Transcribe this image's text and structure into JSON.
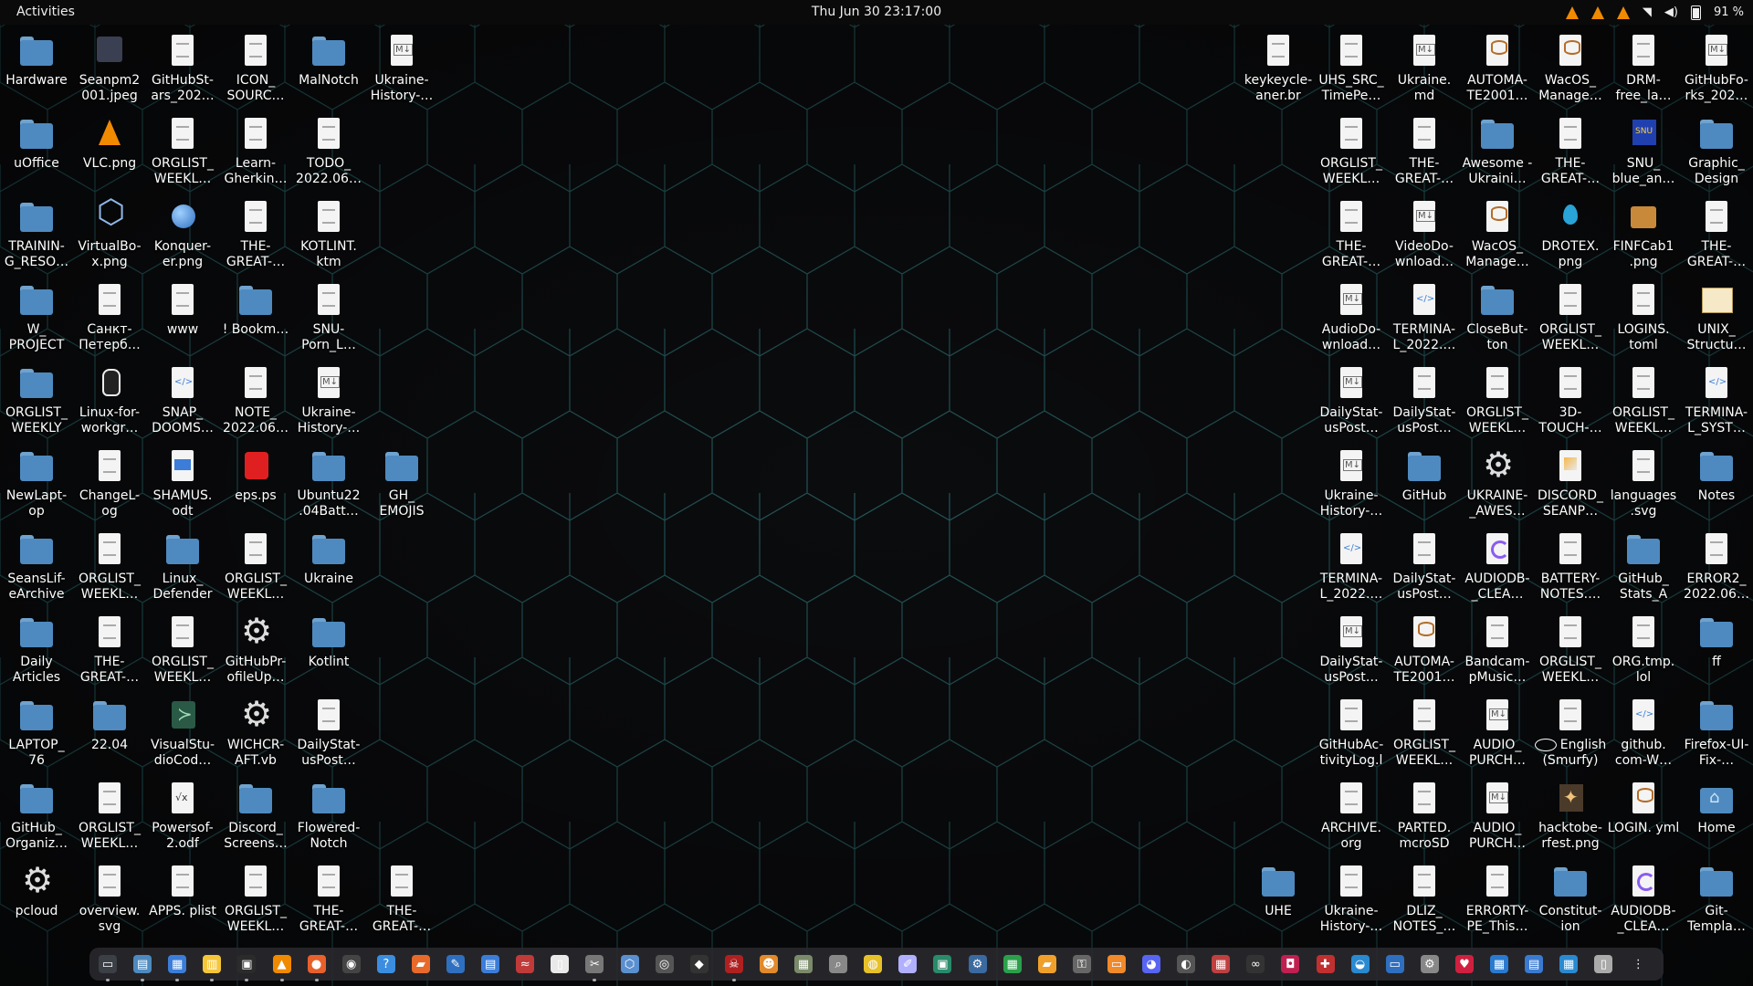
{
  "topbar": {
    "activities": "Activities",
    "clock": "Thu Jun 30  23:17:00",
    "battery": "91 %"
  },
  "desktop": {
    "left_icons": [
      {
        "label": "Hardware",
        "icon": "folder"
      },
      {
        "label": "Seanpm2 001.jpeg",
        "icon": "image"
      },
      {
        "label": "GitHubSt-ars_202…",
        "icon": "document"
      },
      {
        "label": "ICON_ SOURC…",
        "icon": "document"
      },
      {
        "label": "MalNotch",
        "icon": "folder"
      },
      {
        "label": "Ukraine-History-…",
        "icon": "markdown"
      },
      {
        "label": "uOffice",
        "icon": "folder"
      },
      {
        "label": "VLC.png",
        "icon": "vlc"
      },
      {
        "label": "ORGLIST_ WEEKL…",
        "icon": "document"
      },
      {
        "label": "Learn-Gherkin…",
        "icon": "document"
      },
      {
        "label": "TODO_ 2022.06…",
        "icon": "document"
      },
      {
        "label": "TRAININ-G_RESO…",
        "icon": "folder"
      },
      {
        "label": "VirtualBo-x.png",
        "icon": "virtualbox"
      },
      {
        "label": "Konquer-er.png",
        "icon": "globe"
      },
      {
        "label": "THE-GREAT-…",
        "icon": "document"
      },
      {
        "label": "KOTLINT. ktm",
        "icon": "document"
      },
      {
        "label": "W_ PROJECT",
        "icon": "folder"
      },
      {
        "label": "Санкт-Петерб…",
        "icon": "document"
      },
      {
        "label": "www",
        "icon": "document"
      },
      {
        "label": "! Bookm…",
        "icon": "folder"
      },
      {
        "label": "SNU-Porn_L…",
        "icon": "document"
      },
      {
        "label": "ORGLIST_ WEEKLY",
        "icon": "folder"
      },
      {
        "label": "Linux-for-workgr…",
        "icon": "tux"
      },
      {
        "label": "SNAP_ DOOMS…",
        "icon": "code"
      },
      {
        "label": "NOTE_ 2022.06…",
        "icon": "document"
      },
      {
        "label": "Ukraine-History-…",
        "icon": "markdown"
      },
      {
        "label": "NewLapt-op",
        "icon": "folder"
      },
      {
        "label": "ChangeL-og",
        "icon": "document"
      },
      {
        "label": "SHAMUS. odt",
        "icon": "odt"
      },
      {
        "label": "eps.ps",
        "icon": "postscript"
      },
      {
        "label": "Ubuntu22 .04Batt…",
        "icon": "folder"
      },
      {
        "label": "GH_ EMOJIS",
        "icon": "folder"
      },
      {
        "label": "SeansLif-eArchive",
        "icon": "folder"
      },
      {
        "label": "ORGLIST_ WEEKL…",
        "icon": "document"
      },
      {
        "label": "Linux_ Defender",
        "icon": "folder"
      },
      {
        "label": "ORGLIST_ WEEKL…",
        "icon": "document"
      },
      {
        "label": "Ukraine",
        "icon": "folder"
      },
      {
        "label": "Daily Articles",
        "icon": "folder"
      },
      {
        "label": "THE-GREAT-…",
        "icon": "document"
      },
      {
        "label": "ORGLIST_ WEEKL…",
        "icon": "document"
      },
      {
        "label": "GitHubPr-ofileUp…",
        "icon": "gear"
      },
      {
        "label": "Kotlint",
        "icon": "folder"
      },
      {
        "label": "LAPTOP_ 76",
        "icon": "folder"
      },
      {
        "label": "22.04",
        "icon": "folder"
      },
      {
        "label": "VisualStu-dioCod…",
        "icon": "vscode"
      },
      {
        "label": "WICHCR-AFT.vb",
        "icon": "gear"
      },
      {
        "label": "DailyStat-usPost…",
        "icon": "document"
      },
      {
        "label": "GitHub_ Organiz…",
        "icon": "folder"
      },
      {
        "label": "ORGLIST_ WEEKL…",
        "icon": "document"
      },
      {
        "label": "Powersof-2.odf",
        "icon": "formula"
      },
      {
        "label": "Discord_ Screens…",
        "icon": "folder"
      },
      {
        "label": "Flowered-Notch",
        "icon": "folder"
      },
      {
        "label": "pcloud",
        "icon": "gear"
      },
      {
        "label": "overview. svg",
        "icon": "document"
      },
      {
        "label": "APPS. plist",
        "icon": "document"
      },
      {
        "label": "ORGLIST_ WEEKL…",
        "icon": "document"
      },
      {
        "label": "THE-GREAT-…",
        "icon": "document"
      },
      {
        "label": "THE-GREAT-…",
        "icon": "document"
      }
    ],
    "right_icons": [
      {
        "label": "keykeycle-aner.br",
        "icon": "document"
      },
      {
        "label": "UHS_SRC_ TimePe…",
        "icon": "document"
      },
      {
        "label": "Ukraine. md",
        "icon": "markdown"
      },
      {
        "label": "AUTOMA-TE2001…",
        "icon": "database"
      },
      {
        "label": "WacOS_ Manage…",
        "icon": "database"
      },
      {
        "label": "DRM-free_la…",
        "icon": "document"
      },
      {
        "label": "GitHubFo-rks_202…",
        "icon": "markdown"
      },
      {
        "label": "ORGLIST_ WEEKL…",
        "icon": "document"
      },
      {
        "label": "THE-GREAT-…",
        "icon": "document"
      },
      {
        "label": "Awesome -Ukraini…",
        "icon": "folder"
      },
      {
        "label": "THE-GREAT-…",
        "icon": "document"
      },
      {
        "label": "SNU_ blue_an…",
        "icon": "snu"
      },
      {
        "label": "Graphic_ Design",
        "icon": "folder"
      },
      {
        "label": "THE-GREAT-…",
        "icon": "document"
      },
      {
        "label": "VideoDo-wnload…",
        "icon": "markdown"
      },
      {
        "label": "WacOS_ Manage…",
        "icon": "database"
      },
      {
        "label": "DROTEX. png",
        "icon": "drop"
      },
      {
        "label": "FINFCab1 .png",
        "icon": "cabinet"
      },
      {
        "label": "THE-GREAT-…",
        "icon": "document"
      },
      {
        "label": "AudioDo-wnload…",
        "icon": "markdown"
      },
      {
        "label": "TERMINA-L_2022.…",
        "icon": "code"
      },
      {
        "label": "CloseBut-ton",
        "icon": "folder"
      },
      {
        "label": "ORGLIST_ WEEKL…",
        "icon": "document"
      },
      {
        "label": "LOGINS. toml",
        "icon": "document"
      },
      {
        "label": "UNIX_ Structu…",
        "icon": "unix"
      },
      {
        "label": "DailyStat-usPost…",
        "icon": "markdown"
      },
      {
        "label": "DailyStat-usPost…",
        "icon": "document"
      },
      {
        "label": "ORGLIST_ WEEKL…",
        "icon": "document"
      },
      {
        "label": "3D-TOUCH-…",
        "icon": "document"
      },
      {
        "label": "ORGLIST_ WEEKL…",
        "icon": "document"
      },
      {
        "label": "TERMINA-L_SYST…",
        "icon": "code"
      },
      {
        "label": "Ukraine-History-…",
        "icon": "markdown"
      },
      {
        "label": "GitHub",
        "icon": "folder"
      },
      {
        "label": "UKRAINE-_AWES…",
        "icon": "gear"
      },
      {
        "label": "DISCORD_ SEANP…",
        "icon": "svg"
      },
      {
        "label": "languages .svg",
        "icon": "document"
      },
      {
        "label": "Notes",
        "icon": "folder"
      },
      {
        "label": "TERMINA-L_2022.…",
        "icon": "code"
      },
      {
        "label": "DailyStat-usPost…",
        "icon": "document"
      },
      {
        "label": "AUDIODB-_CLEA…",
        "icon": "audio"
      },
      {
        "label": "BATTERY-NOTES.…",
        "icon": "document"
      },
      {
        "label": "GitHub_ Stats_A",
        "icon": "folder"
      },
      {
        "label": "ERROR2_ 2022.06…",
        "icon": "document"
      },
      {
        "label": "DailyStat-usPost…",
        "icon": "markdown"
      },
      {
        "label": "AUTOMA-TE2001…",
        "icon": "database"
      },
      {
        "label": "Bandcam-pMusic…",
        "icon": "document"
      },
      {
        "label": "ORGLIST_ WEEKL…",
        "icon": "document"
      },
      {
        "label": "ORG.tmp. lol",
        "icon": "document"
      },
      {
        "label": "ff",
        "icon": "folder"
      },
      {
        "label": "GitHubAc-tivityLog.l",
        "icon": "document"
      },
      {
        "label": "ORGLIST_ WEEKL…",
        "icon": "document"
      },
      {
        "label": "AUDIO_ PURCH…",
        "icon": "markdown"
      },
      {
        "label": "English (Smurfy)",
        "icon": "document",
        "prefix_selected": true
      },
      {
        "label": "github. com-W…",
        "icon": "code"
      },
      {
        "label": "Firefox-UI-Fix-…",
        "icon": "folder"
      },
      {
        "label": "ARCHIVE. org",
        "icon": "document"
      },
      {
        "label": "PARTED. mcroSD",
        "icon": "document"
      },
      {
        "label": "AUDIO_ PURCH…",
        "icon": "markdown"
      },
      {
        "label": "hacktobe-rfest.png",
        "icon": "hacktoberfest"
      },
      {
        "label": "LOGIN. yml",
        "icon": "database"
      },
      {
        "label": "Home",
        "icon": "home"
      },
      {
        "label": "UHE",
        "icon": "folder"
      },
      {
        "label": "Ukraine-History-…",
        "icon": "document"
      },
      {
        "label": "DLIZ_ NOTES_…",
        "icon": "document"
      },
      {
        "label": "ERRORTY-PE_This…",
        "icon": "document"
      },
      {
        "label": "Constitut-ion",
        "icon": "folder"
      },
      {
        "label": "AUDIODB-_CLEA…",
        "icon": "audio"
      },
      {
        "label": "Git-Templa…",
        "icon": "folder"
      }
    ]
  },
  "dock": {
    "items": [
      {
        "name": "terminal",
        "color": "#3b3f46",
        "glyph": "▭"
      },
      {
        "name": "files",
        "color": "#4e8abf",
        "glyph": "▤"
      },
      {
        "name": "text-editor",
        "color": "#3b7dd8",
        "glyph": "▦"
      },
      {
        "name": "notes",
        "color": "#f5c63a",
        "glyph": "▥"
      },
      {
        "name": "console",
        "color": "#2b2b2b",
        "glyph": "▣"
      },
      {
        "name": "vlc",
        "color": "#f08a00",
        "glyph": "▲"
      },
      {
        "name": "firefox",
        "color": "#e8602b",
        "glyph": "●"
      },
      {
        "name": "obs",
        "color": "#444",
        "glyph": "◉"
      },
      {
        "name": "help",
        "color": "#3b8de0",
        "glyph": "?"
      },
      {
        "name": "software",
        "color": "#e86a2b",
        "glyph": "▰"
      },
      {
        "name": "writer",
        "color": "#2f6fbf",
        "glyph": "✎"
      },
      {
        "name": "document-viewer",
        "color": "#3b7dd8",
        "glyph": "▤"
      },
      {
        "name": "system-monitor",
        "color": "#c03a3a",
        "glyph": "≈"
      },
      {
        "name": "blank-doc",
        "color": "#e9e9e9",
        "glyph": "▯"
      },
      {
        "name": "tool",
        "color": "#777",
        "glyph": "✂"
      },
      {
        "name": "virtualbox",
        "color": "#5a8fd0",
        "glyph": "⬡"
      },
      {
        "name": "camera",
        "color": "#555",
        "glyph": "◎"
      },
      {
        "name": "inkscape",
        "color": "#333",
        "glyph": "◆"
      },
      {
        "name": "pirate-app",
        "color": "#b02020",
        "glyph": "☠"
      },
      {
        "name": "mascot-app",
        "color": "#e28a2a",
        "glyph": "☻"
      },
      {
        "name": "archive",
        "color": "#7a8a6a",
        "glyph": "▦"
      },
      {
        "name": "search",
        "color": "#888",
        "glyph": "⌕"
      },
      {
        "name": "chrome",
        "color": "#e6c12a",
        "glyph": "◍"
      },
      {
        "name": "paint",
        "color": "#b0b0ff",
        "glyph": "✐"
      },
      {
        "name": "monitor",
        "color": "#2a8a6a",
        "glyph": "▣"
      },
      {
        "name": "settings",
        "color": "#3a6aa0",
        "glyph": "⚙"
      },
      {
        "name": "spreadsheet",
        "color": "#2aa04a",
        "glyph": "▦"
      },
      {
        "name": "folder-app",
        "color": "#f0a02a",
        "glyph": "▰"
      },
      {
        "name": "lock-app",
        "color": "#666",
        "glyph": "⚿"
      },
      {
        "name": "presentation",
        "color": "#f08a2a",
        "glyph": "▭"
      },
      {
        "name": "discord",
        "color": "#5865f2",
        "glyph": "◕"
      },
      {
        "name": "sound",
        "color": "#555",
        "glyph": "◐"
      },
      {
        "name": "calendar",
        "color": "#c04040",
        "glyph": "▦"
      },
      {
        "name": "pocket",
        "color": "#333",
        "glyph": "∞"
      },
      {
        "name": "recorder",
        "color": "#c02050",
        "glyph": "◘"
      },
      {
        "name": "gift",
        "color": "#c03030",
        "glyph": "✚"
      },
      {
        "name": "edge",
        "color": "#2a8ad0",
        "glyph": "◒"
      },
      {
        "name": "keyboard",
        "color": "#2f6fbf",
        "glyph": "▭"
      },
      {
        "name": "gear-alt",
        "color": "#888",
        "glyph": "⚙"
      },
      {
        "name": "heart-app",
        "color": "#d02040",
        "glyph": "♥"
      },
      {
        "name": "windows-app",
        "color": "#2a7ad0",
        "glyph": "▦"
      },
      {
        "name": "calc",
        "color": "#3a7ad0",
        "glyph": "▤"
      },
      {
        "name": "tiles",
        "color": "#2a8ad0",
        "glyph": "▦"
      },
      {
        "name": "trash",
        "color": "#aaa",
        "glyph": "▯"
      },
      {
        "name": "show-apps",
        "color": "#0000",
        "glyph": "⋮"
      }
    ]
  }
}
